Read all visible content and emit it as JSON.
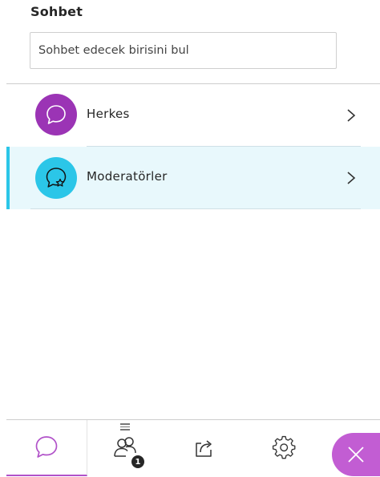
{
  "panel": {
    "title": "Sohbet"
  },
  "search": {
    "placeholder": "Sohbet edecek birisini bul"
  },
  "channels": [
    {
      "label": "Herkes",
      "icon": "chat-bubble-icon",
      "color": "#9b34b5",
      "selected": false
    },
    {
      "label": "Moderatörler",
      "icon": "chat-star-icon",
      "color": "#2bc6e8",
      "selected": true
    }
  ],
  "bottom_nav": {
    "items": [
      {
        "name": "chat",
        "icon": "chat-bubble-icon",
        "active": true
      },
      {
        "name": "participants",
        "icon": "participants-icon",
        "badge": "1"
      },
      {
        "name": "share",
        "icon": "share-icon"
      },
      {
        "name": "settings",
        "icon": "gear-icon"
      }
    ],
    "close_icon": "close-icon"
  },
  "colors": {
    "accent": "#b152c9",
    "highlight_bg": "#e8f8fc",
    "highlight_bar": "#2bc6e8"
  }
}
